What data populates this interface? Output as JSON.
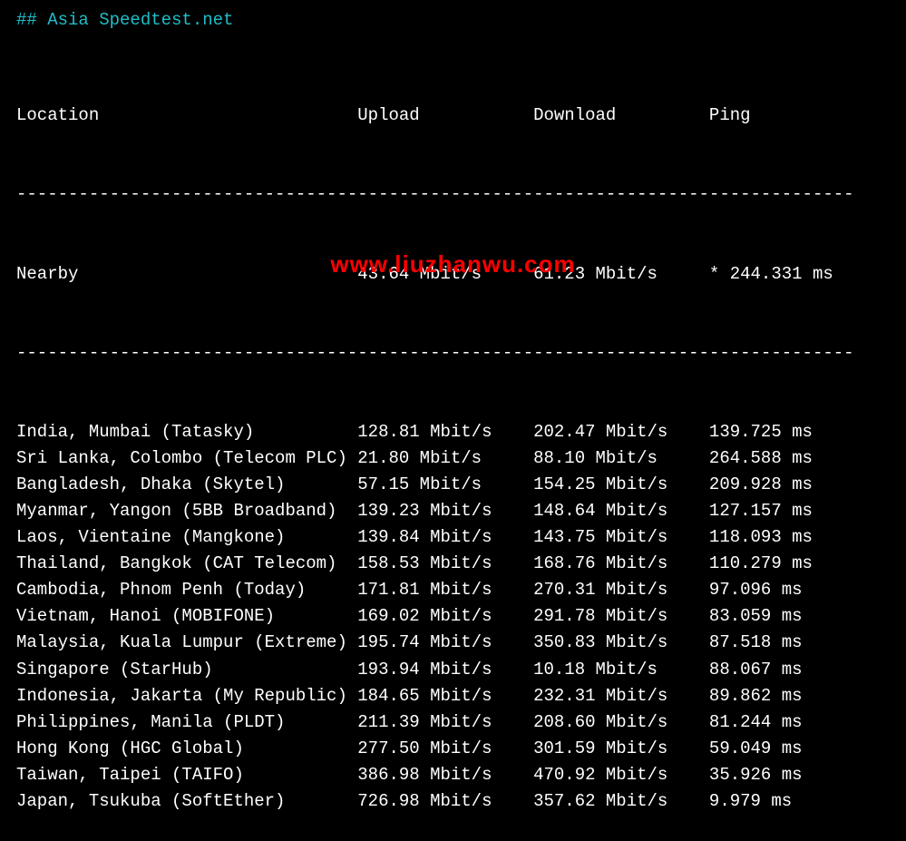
{
  "title": "## Asia Speedtest.net",
  "headers": {
    "location": "Location",
    "upload": "Upload",
    "download": "Download",
    "ping": "Ping"
  },
  "nearby": {
    "location": "Nearby",
    "upload": "43.64 Mbit/s",
    "download": "61.23 Mbit/s",
    "ping": "* 244.331 ms"
  },
  "rows": [
    {
      "location": "India, Mumbai (Tatasky)",
      "upload": "128.81 Mbit/s",
      "download": "202.47 Mbit/s",
      "ping": "139.725 ms"
    },
    {
      "location": "Sri Lanka, Colombo (Telecom PLC)",
      "upload": "21.80 Mbit/s",
      "download": "88.10 Mbit/s",
      "ping": "264.588 ms"
    },
    {
      "location": "Bangladesh, Dhaka (Skytel)",
      "upload": "57.15 Mbit/s",
      "download": "154.25 Mbit/s",
      "ping": "209.928 ms"
    },
    {
      "location": "Myanmar, Yangon (5BB Broadband)",
      "upload": "139.23 Mbit/s",
      "download": "148.64 Mbit/s",
      "ping": "127.157 ms"
    },
    {
      "location": "Laos, Vientaine (Mangkone)",
      "upload": "139.84 Mbit/s",
      "download": "143.75 Mbit/s",
      "ping": "118.093 ms"
    },
    {
      "location": "Thailand, Bangkok (CAT Telecom)",
      "upload": "158.53 Mbit/s",
      "download": "168.76 Mbit/s",
      "ping": "110.279 ms"
    },
    {
      "location": "Cambodia, Phnom Penh (Today)",
      "upload": "171.81 Mbit/s",
      "download": "270.31 Mbit/s",
      "ping": "97.096 ms"
    },
    {
      "location": "Vietnam, Hanoi (MOBIFONE)",
      "upload": "169.02 Mbit/s",
      "download": "291.78 Mbit/s",
      "ping": "83.059 ms"
    },
    {
      "location": "Malaysia, Kuala Lumpur (Extreme)",
      "upload": "195.74 Mbit/s",
      "download": "350.83 Mbit/s",
      "ping": "87.518 ms"
    },
    {
      "location": "Singapore (StarHub)",
      "upload": "193.94 Mbit/s",
      "download": "10.18 Mbit/s",
      "ping": "88.067 ms"
    },
    {
      "location": "Indonesia, Jakarta (My Republic)",
      "upload": "184.65 Mbit/s",
      "download": "232.31 Mbit/s",
      "ping": "89.862 ms"
    },
    {
      "location": "Philippines, Manila (PLDT)",
      "upload": "211.39 Mbit/s",
      "download": "208.60 Mbit/s",
      "ping": "81.244 ms"
    },
    {
      "location": "Hong Kong (HGC Global)",
      "upload": "277.50 Mbit/s",
      "download": "301.59 Mbit/s",
      "ping": "59.049 ms"
    },
    {
      "location": "Taiwan, Taipei (TAIFO)",
      "upload": "386.98 Mbit/s",
      "download": "470.92 Mbit/s",
      "ping": "35.926 ms"
    },
    {
      "location": "Japan, Tsukuba (SoftEther)",
      "upload": "726.98 Mbit/s",
      "download": "357.62 Mbit/s",
      "ping": "9.979 ms"
    }
  ],
  "divider": "---------------------------------------------------------------------------------",
  "watermark": "www.liuzhanwu.com"
}
